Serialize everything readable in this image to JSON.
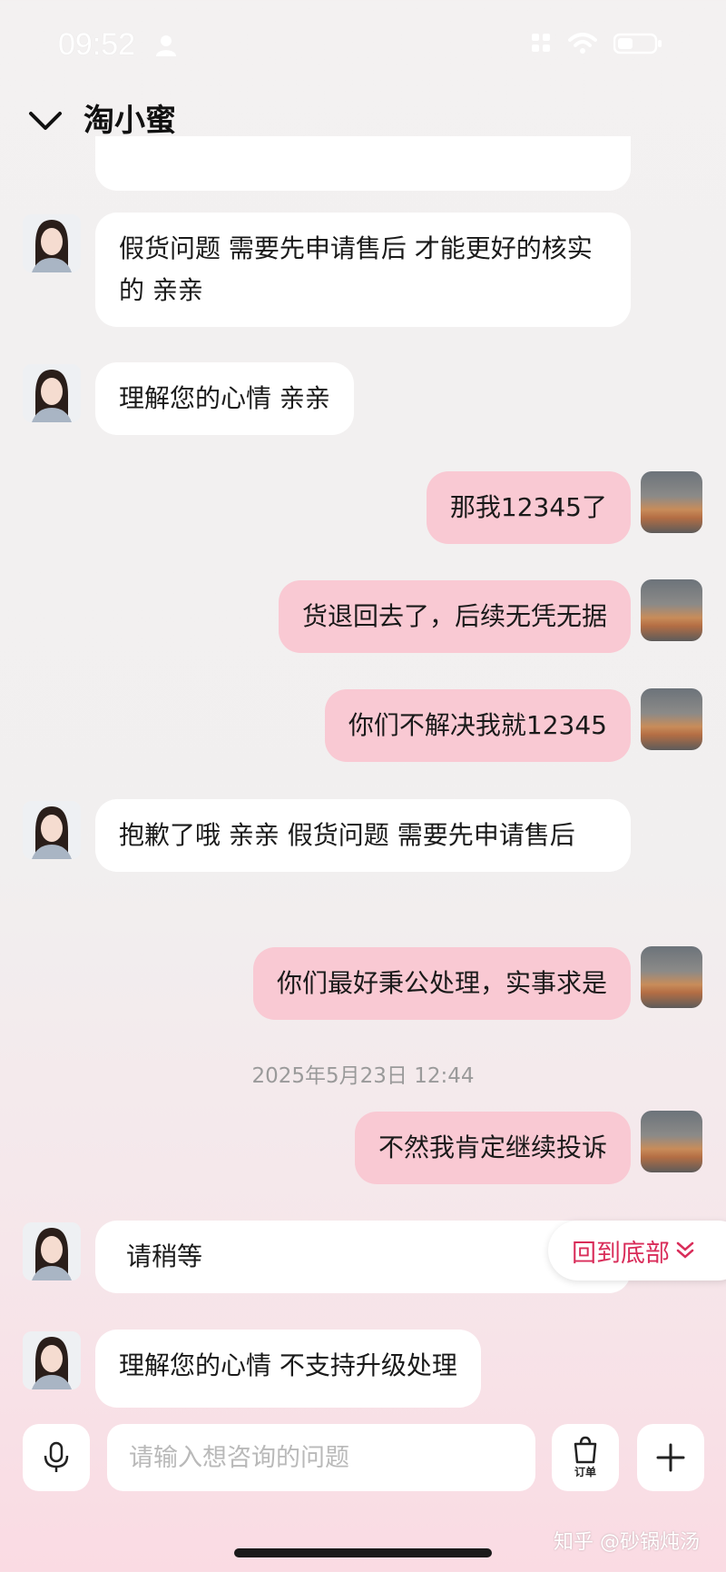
{
  "status_bar": {
    "time": "09:52"
  },
  "header": {
    "title": "淘小蜜"
  },
  "messages": [
    {
      "sender": "bot",
      "text": "假货问题 需要先申请售后  才能更好的核实的 亲亲"
    },
    {
      "sender": "bot",
      "text": "理解您的心情 亲亲"
    },
    {
      "sender": "user",
      "text": "那我12345了"
    },
    {
      "sender": "user",
      "text": "货退回去了，后续无凭无据"
    },
    {
      "sender": "user",
      "text": "你们不解决我就12345"
    },
    {
      "sender": "bot",
      "text": "抱歉了哦 亲亲 假货问题 需要先申请售后"
    },
    {
      "sender": "user",
      "text": "你们最好秉公处理，实事求是"
    },
    {
      "sender": "user",
      "text": "不然我肯定继续投诉"
    },
    {
      "sender": "bot",
      "text": "请稍等"
    },
    {
      "sender": "bot",
      "text": "理解您的心情 不支持升级处理"
    }
  ],
  "timestamp": "2025年5月23日 12:44",
  "back_to_bottom": {
    "label": "回到底部"
  },
  "input": {
    "placeholder": "请输入想咨询的问题",
    "order_label": "订单"
  },
  "watermark": "知乎 @砂锅炖汤",
  "colors": {
    "user_bubble": "#f9c9d3",
    "bot_bubble": "#ffffff",
    "accent": "#d92d5a"
  }
}
